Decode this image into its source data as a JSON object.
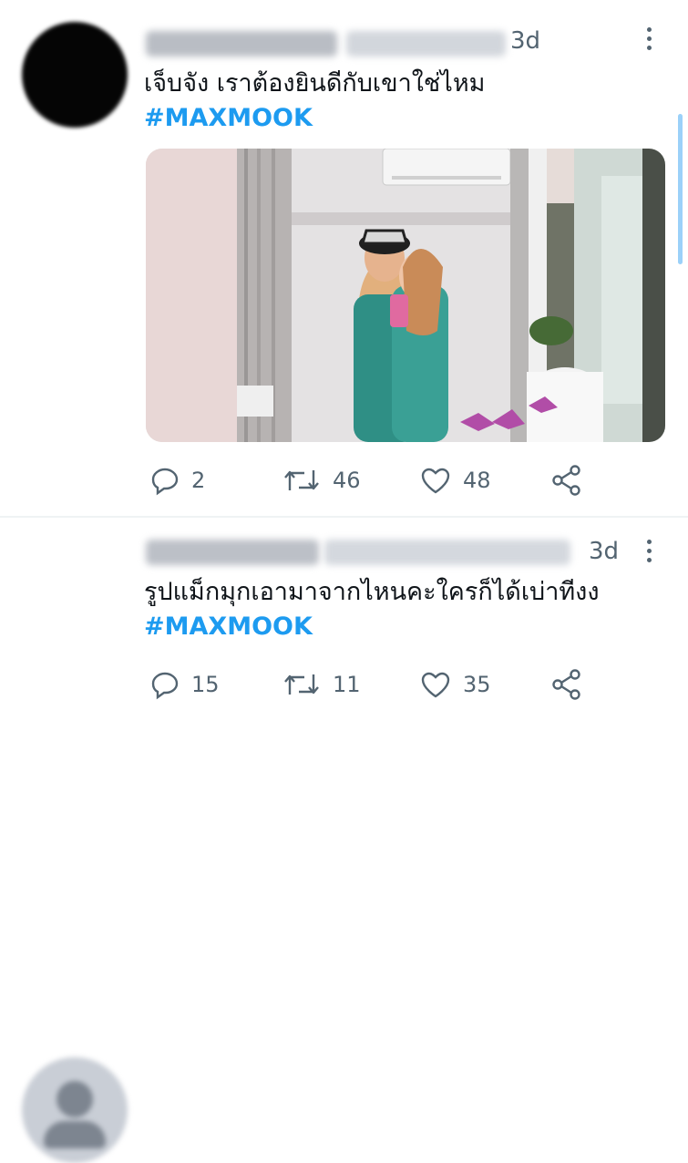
{
  "tweets": [
    {
      "time": "3d",
      "text": "เจ็บจัง เราต้องยินดีกับเขาใช่ไหม",
      "hashtag": "#MAXMOOK",
      "actions": {
        "replies": "2",
        "retweets": "46",
        "likes": "48"
      }
    },
    {
      "time": "3d",
      "text": "รูปแม็กมุกเอามาจากไหนคะใครก็ได้เบ่าทีงง",
      "hashtag": "#MAXMOOK",
      "actions": {
        "replies": "15",
        "retweets": "11",
        "likes": "35"
      }
    }
  ],
  "icons": [
    "more-icon",
    "reply-icon",
    "retweet-icon",
    "like-icon",
    "share-icon"
  ],
  "colors": {
    "accent": "#1d9bf0",
    "muted": "#536471",
    "text": "#0f1419",
    "divider": "#eff3f4"
  }
}
